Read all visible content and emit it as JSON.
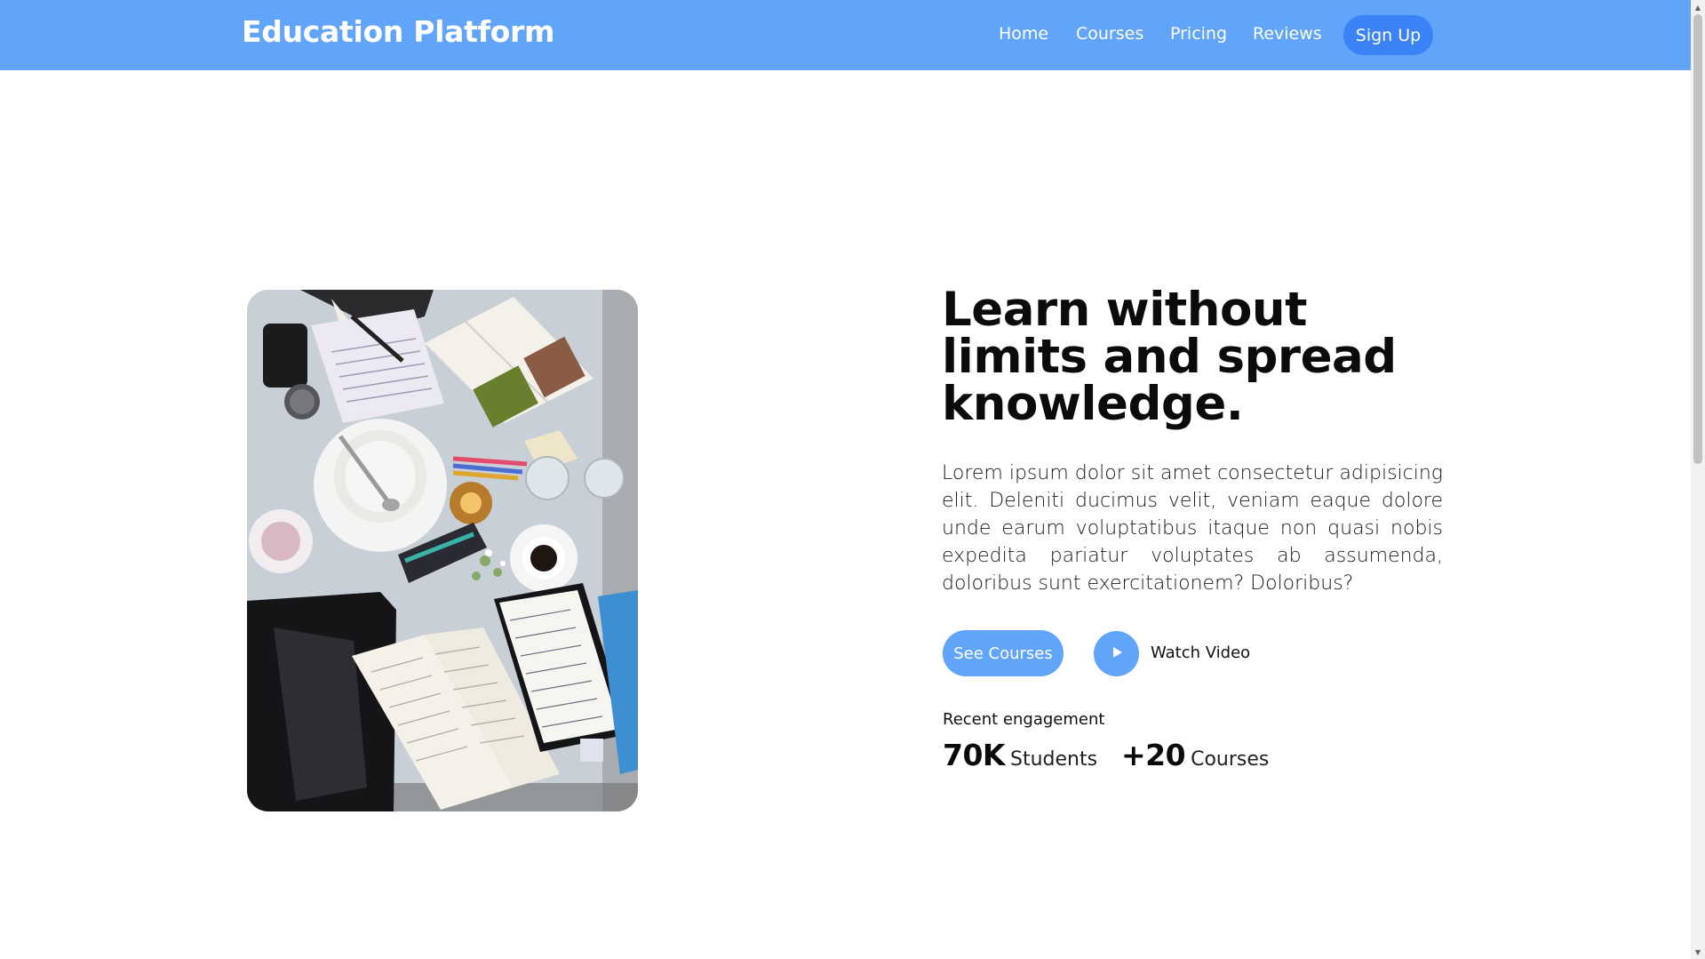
{
  "header": {
    "brand": "Education Platform",
    "nav": {
      "home": "Home",
      "courses": "Courses",
      "pricing": "Pricing",
      "reviews": "Reviews"
    },
    "signup": "Sign Up"
  },
  "hero": {
    "title": "Learn without limits and spread knowledge.",
    "paragraph": "Lorem ipsum dolor sit amet consectetur adipisicing elit. Deleniti ducimus velit, veniam eaque dolore unde earum voluptatibus itaque non quasi nobis expedita pariatur voluptates ab assumenda, doloribus sunt exercitationem? Doloribus?",
    "see_courses": "See Courses",
    "watch_video": "Watch Video",
    "play_icon": "play-icon",
    "engagement_label": "Recent engagement",
    "stats": {
      "students": {
        "number": "70K",
        "label": "Students"
      },
      "courses": {
        "number": "+20",
        "label": "Courses"
      }
    }
  },
  "colors": {
    "header_bg": "#60a5fa",
    "signup_bg": "#3b82f6",
    "accent": "#60a5fa"
  }
}
